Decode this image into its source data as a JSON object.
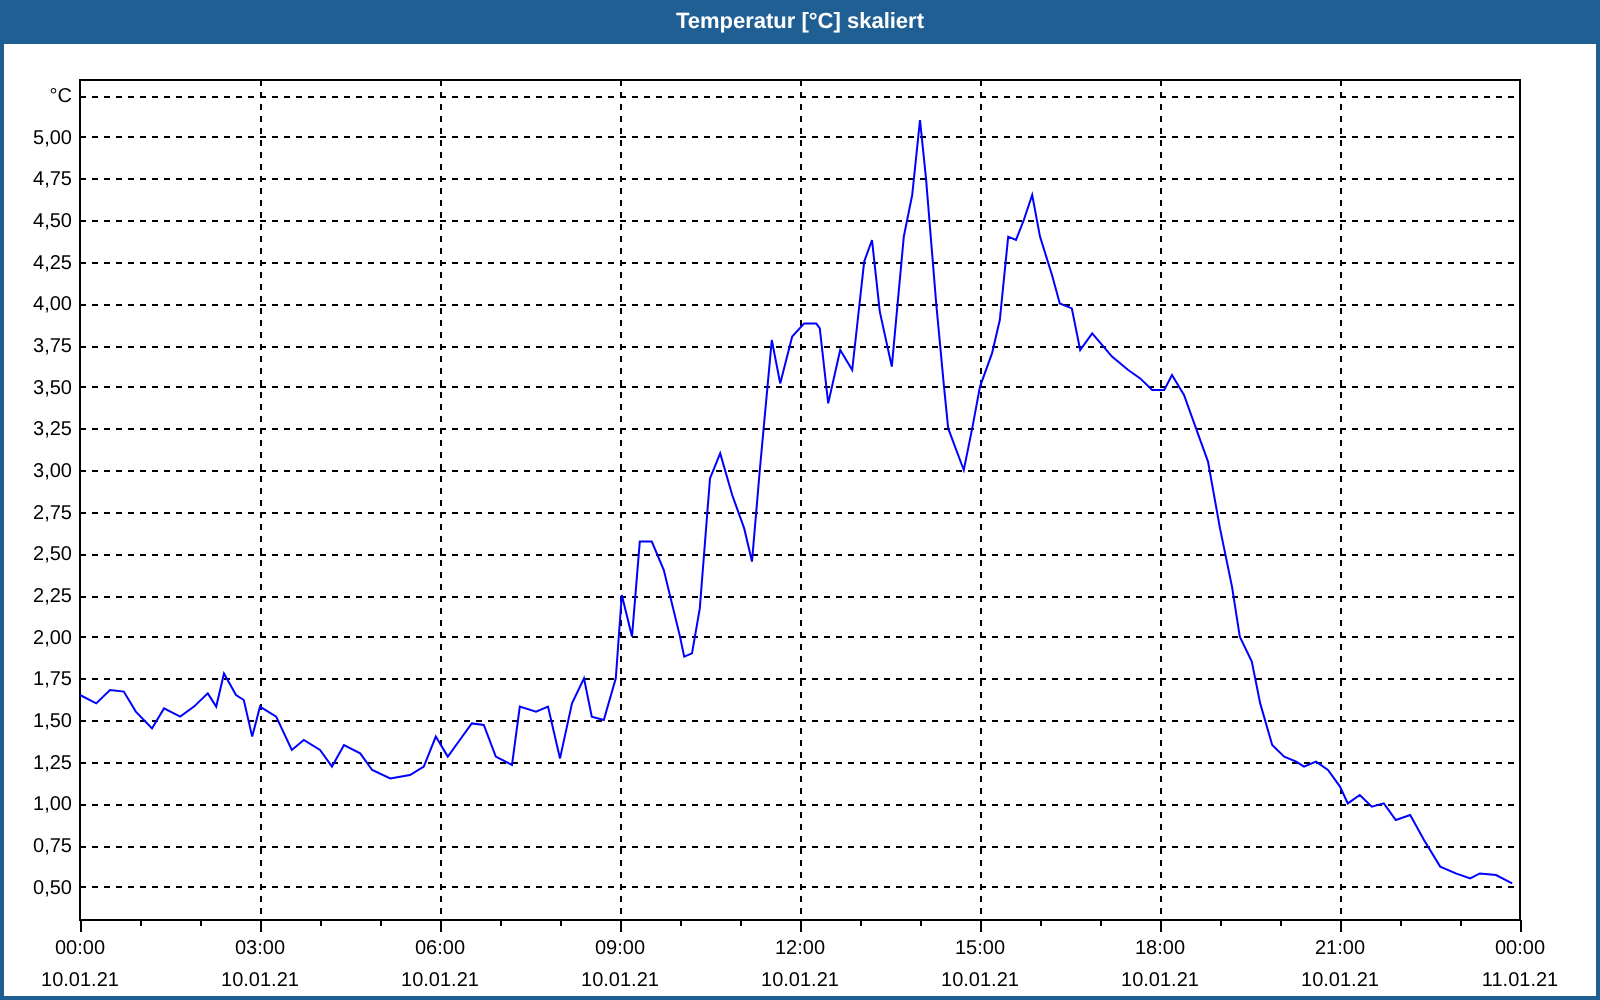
{
  "window": {
    "title": "Temperatur [°C] skaliert"
  },
  "chart": {
    "chart_data": {
      "type": "line",
      "ylabel": "°C",
      "x": [
        0,
        0.27,
        0.5,
        0.73,
        0.93,
        1.2,
        1.4,
        1.67,
        1.9,
        2.13,
        2.27,
        2.4,
        2.6,
        2.73,
        2.87,
        3,
        3.27,
        3.53,
        3.73,
        4,
        4.2,
        4.4,
        4.67,
        4.87,
        5.17,
        5.5,
        5.73,
        5.93,
        6.13,
        6.33,
        6.53,
        6.73,
        6.93,
        7.2,
        7.33,
        7.6,
        7.8,
        8,
        8.2,
        8.4,
        8.53,
        8.73,
        8.93,
        9.03,
        9.2,
        9.33,
        9.53,
        9.73,
        10,
        10.07,
        10.2,
        10.33,
        10.5,
        10.67,
        10.87,
        11.07,
        11.2,
        11.33,
        11.53,
        11.67,
        11.87,
        12.07,
        12.27,
        12.33,
        12.47,
        12.67,
        12.87,
        13.07,
        13.2,
        13.33,
        13.53,
        13.73,
        13.87,
        14,
        14.1,
        14.27,
        14.4,
        14.47,
        14.73,
        14.87,
        15,
        15.2,
        15.33,
        15.47,
        15.6,
        15.73,
        15.87,
        16,
        16.2,
        16.33,
        16.53,
        16.67,
        16.87,
        17.2,
        17.47,
        17.67,
        17.87,
        18.07,
        18.2,
        18.4,
        18.6,
        18.8,
        19,
        19.2,
        19.33,
        19.53,
        19.67,
        19.87,
        20.07,
        20.27,
        20.4,
        20.6,
        20.8,
        21,
        21.13,
        21.33,
        21.53,
        21.73,
        21.93,
        22.17,
        22.4,
        22.67,
        22.93,
        23.17,
        23.33,
        23.6,
        23.87
      ],
      "series": [
        {
          "color": "#0000ff",
          "values": [
            1.65,
            1.6,
            1.68,
            1.67,
            1.55,
            1.45,
            1.57,
            1.52,
            1.58,
            1.66,
            1.58,
            1.78,
            1.65,
            1.62,
            1.4,
            1.58,
            1.52,
            1.32,
            1.38,
            1.32,
            1.22,
            1.35,
            1.3,
            1.2,
            1.15,
            1.17,
            1.22,
            1.4,
            1.28,
            1.38,
            1.48,
            1.47,
            1.28,
            1.23,
            1.58,
            1.55,
            1.58,
            1.27,
            1.6,
            1.75,
            1.52,
            1.5,
            1.75,
            2.25,
            2.0,
            2.57,
            2.57,
            2.4,
            2.0,
            1.88,
            1.9,
            2.17,
            2.95,
            3.1,
            2.85,
            2.65,
            2.45,
            3.0,
            3.78,
            3.52,
            3.8,
            3.88,
            3.88,
            3.85,
            3.4,
            3.72,
            3.6,
            4.25,
            4.38,
            3.95,
            3.62,
            4.4,
            4.65,
            5.1,
            4.75,
            4.0,
            3.5,
            3.25,
            3.0,
            3.25,
            3.5,
            3.7,
            3.9,
            4.4,
            4.38,
            4.5,
            4.65,
            4.4,
            4.17,
            4.0,
            3.97,
            3.72,
            3.82,
            3.68,
            3.6,
            3.55,
            3.48,
            3.48,
            3.57,
            3.45,
            3.25,
            3.05,
            2.65,
            2.3,
            2.0,
            1.85,
            1.6,
            1.35,
            1.28,
            1.25,
            1.22,
            1.25,
            1.2,
            1.1,
            1.0,
            1.05,
            0.98,
            1.0,
            0.9,
            0.93,
            0.78,
            0.62,
            0.58,
            0.55,
            0.58,
            0.57,
            0.52
          ]
        }
      ],
      "grid": true,
      "xlim": [
        0,
        24
      ],
      "ylim": [
        0.3,
        5.34
      ],
      "xticks": [
        {
          "value": 0,
          "label": "00:00"
        },
        {
          "value": 3,
          "label": "03:00"
        },
        {
          "value": 6,
          "label": "06:00"
        },
        {
          "value": 9,
          "label": "09:00"
        },
        {
          "value": 12,
          "label": "12:00"
        },
        {
          "value": 15,
          "label": "15:00"
        },
        {
          "value": 18,
          "label": "18:00"
        },
        {
          "value": 21,
          "label": "21:00"
        },
        {
          "value": 24,
          "label": "00:00"
        }
      ],
      "yticks": [
        {
          "value": 0.5,
          "label": "0,50"
        },
        {
          "value": 0.75,
          "label": "0,75"
        },
        {
          "value": 1,
          "label": "1,00"
        },
        {
          "value": 1.25,
          "label": "1,25"
        },
        {
          "value": 1.5,
          "label": "1,50"
        },
        {
          "value": 1.75,
          "label": "1,75"
        },
        {
          "value": 2,
          "label": "2,00"
        },
        {
          "value": 2.25,
          "label": "2,25"
        },
        {
          "value": 2.5,
          "label": "2,50"
        },
        {
          "value": 2.75,
          "label": "2,75"
        },
        {
          "value": 3,
          "label": "3,00"
        },
        {
          "value": 3.25,
          "label": "3,25"
        },
        {
          "value": 3.5,
          "label": "3,50"
        },
        {
          "value": 3.75,
          "label": "3,75"
        },
        {
          "value": 4,
          "label": "4,00"
        },
        {
          "value": 4.25,
          "label": "4,25"
        },
        {
          "value": 4.5,
          "label": "4,50"
        },
        {
          "value": 4.75,
          "label": "4,75"
        },
        {
          "value": 5,
          "label": "5,00"
        }
      ]
    },
    "x_axis_dates": [
      "10.01.21",
      "10.01.21",
      "10.01.21",
      "10.01.21",
      "10.01.21",
      "10.01.21",
      "10.01.21",
      "10.01.21",
      "11.01.21"
    ]
  }
}
